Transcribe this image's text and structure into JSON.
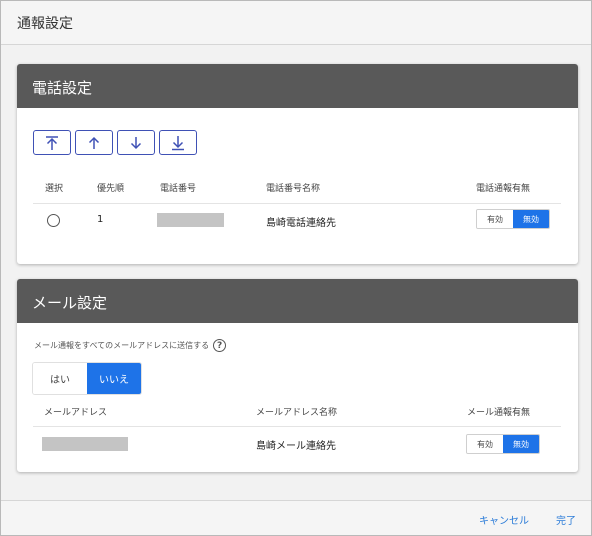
{
  "dialog": {
    "title": "通報設定"
  },
  "phone": {
    "section_title": "電話設定",
    "order_buttons": [
      {
        "icon": "move-to-top-icon"
      },
      {
        "icon": "move-up-icon"
      },
      {
        "icon": "move-down-icon"
      },
      {
        "icon": "move-to-bottom-icon"
      }
    ],
    "columns": {
      "select": "選択",
      "priority": "優先順",
      "number": "電話番号",
      "number_name": "電話番号名称",
      "notify_enabled": "電話通報有無"
    },
    "rows": [
      {
        "priority": "1",
        "number": "",
        "number_name": "島崎電話連絡先",
        "toggle_on": "有効",
        "toggle_off": "無効",
        "selected_state": "無効"
      }
    ]
  },
  "mail": {
    "section_title": "メール設定",
    "send_all_label": "メール通報をすべてのメールアドレスに送信する",
    "help_glyph": "?",
    "yes_label": "はい",
    "no_label": "いいえ",
    "selected": "いいえ",
    "columns": {
      "address": "メールアドレス",
      "address_name": "メールアドレス名称",
      "notify_enabled": "メール通報有無"
    },
    "rows": [
      {
        "address": "",
        "address_name": "島崎メール連絡先",
        "toggle_on": "有効",
        "toggle_off": "無効",
        "selected_state": "無効"
      }
    ]
  },
  "footer": {
    "cancel_label": "キャンセル",
    "done_label": "完了"
  },
  "colors": {
    "section_header": "#595959",
    "accent": "#1e73e8",
    "order_button_border": "#3f51b5",
    "link": "#2a7bd8"
  }
}
